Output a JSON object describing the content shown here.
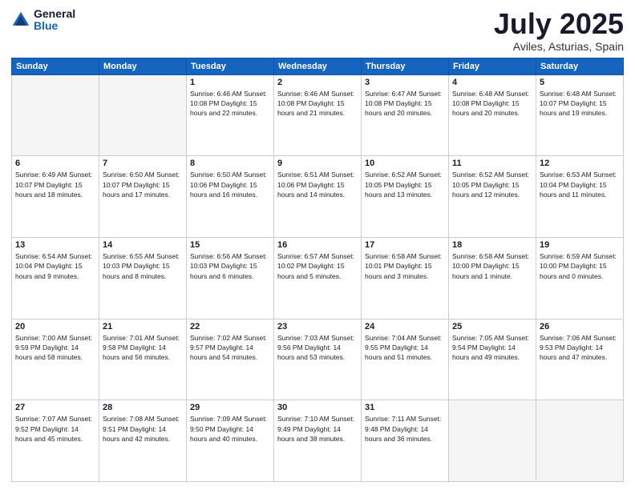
{
  "logo": {
    "general": "General",
    "blue": "Blue"
  },
  "title": "July 2025",
  "location": "Aviles, Asturias, Spain",
  "days_of_week": [
    "Sunday",
    "Monday",
    "Tuesday",
    "Wednesday",
    "Thursday",
    "Friday",
    "Saturday"
  ],
  "weeks": [
    [
      {
        "day": "",
        "info": ""
      },
      {
        "day": "",
        "info": ""
      },
      {
        "day": "1",
        "info": "Sunrise: 6:46 AM\nSunset: 10:08 PM\nDaylight: 15 hours\nand 22 minutes."
      },
      {
        "day": "2",
        "info": "Sunrise: 6:46 AM\nSunset: 10:08 PM\nDaylight: 15 hours\nand 21 minutes."
      },
      {
        "day": "3",
        "info": "Sunrise: 6:47 AM\nSunset: 10:08 PM\nDaylight: 15 hours\nand 20 minutes."
      },
      {
        "day": "4",
        "info": "Sunrise: 6:48 AM\nSunset: 10:08 PM\nDaylight: 15 hours\nand 20 minutes."
      },
      {
        "day": "5",
        "info": "Sunrise: 6:48 AM\nSunset: 10:07 PM\nDaylight: 15 hours\nand 19 minutes."
      }
    ],
    [
      {
        "day": "6",
        "info": "Sunrise: 6:49 AM\nSunset: 10:07 PM\nDaylight: 15 hours\nand 18 minutes."
      },
      {
        "day": "7",
        "info": "Sunrise: 6:50 AM\nSunset: 10:07 PM\nDaylight: 15 hours\nand 17 minutes."
      },
      {
        "day": "8",
        "info": "Sunrise: 6:50 AM\nSunset: 10:06 PM\nDaylight: 15 hours\nand 16 minutes."
      },
      {
        "day": "9",
        "info": "Sunrise: 6:51 AM\nSunset: 10:06 PM\nDaylight: 15 hours\nand 14 minutes."
      },
      {
        "day": "10",
        "info": "Sunrise: 6:52 AM\nSunset: 10:05 PM\nDaylight: 15 hours\nand 13 minutes."
      },
      {
        "day": "11",
        "info": "Sunrise: 6:52 AM\nSunset: 10:05 PM\nDaylight: 15 hours\nand 12 minutes."
      },
      {
        "day": "12",
        "info": "Sunrise: 6:53 AM\nSunset: 10:04 PM\nDaylight: 15 hours\nand 11 minutes."
      }
    ],
    [
      {
        "day": "13",
        "info": "Sunrise: 6:54 AM\nSunset: 10:04 PM\nDaylight: 15 hours\nand 9 minutes."
      },
      {
        "day": "14",
        "info": "Sunrise: 6:55 AM\nSunset: 10:03 PM\nDaylight: 15 hours\nand 8 minutes."
      },
      {
        "day": "15",
        "info": "Sunrise: 6:56 AM\nSunset: 10:03 PM\nDaylight: 15 hours\nand 6 minutes."
      },
      {
        "day": "16",
        "info": "Sunrise: 6:57 AM\nSunset: 10:02 PM\nDaylight: 15 hours\nand 5 minutes."
      },
      {
        "day": "17",
        "info": "Sunrise: 6:58 AM\nSunset: 10:01 PM\nDaylight: 15 hours\nand 3 minutes."
      },
      {
        "day": "18",
        "info": "Sunrise: 6:58 AM\nSunset: 10:00 PM\nDaylight: 15 hours\nand 1 minute."
      },
      {
        "day": "19",
        "info": "Sunrise: 6:59 AM\nSunset: 10:00 PM\nDaylight: 15 hours\nand 0 minutes."
      }
    ],
    [
      {
        "day": "20",
        "info": "Sunrise: 7:00 AM\nSunset: 9:59 PM\nDaylight: 14 hours\nand 58 minutes."
      },
      {
        "day": "21",
        "info": "Sunrise: 7:01 AM\nSunset: 9:58 PM\nDaylight: 14 hours\nand 56 minutes."
      },
      {
        "day": "22",
        "info": "Sunrise: 7:02 AM\nSunset: 9:57 PM\nDaylight: 14 hours\nand 54 minutes."
      },
      {
        "day": "23",
        "info": "Sunrise: 7:03 AM\nSunset: 9:56 PM\nDaylight: 14 hours\nand 53 minutes."
      },
      {
        "day": "24",
        "info": "Sunrise: 7:04 AM\nSunset: 9:55 PM\nDaylight: 14 hours\nand 51 minutes."
      },
      {
        "day": "25",
        "info": "Sunrise: 7:05 AM\nSunset: 9:54 PM\nDaylight: 14 hours\nand 49 minutes."
      },
      {
        "day": "26",
        "info": "Sunrise: 7:06 AM\nSunset: 9:53 PM\nDaylight: 14 hours\nand 47 minutes."
      }
    ],
    [
      {
        "day": "27",
        "info": "Sunrise: 7:07 AM\nSunset: 9:52 PM\nDaylight: 14 hours\nand 45 minutes."
      },
      {
        "day": "28",
        "info": "Sunrise: 7:08 AM\nSunset: 9:51 PM\nDaylight: 14 hours\nand 42 minutes."
      },
      {
        "day": "29",
        "info": "Sunrise: 7:09 AM\nSunset: 9:50 PM\nDaylight: 14 hours\nand 40 minutes."
      },
      {
        "day": "30",
        "info": "Sunrise: 7:10 AM\nSunset: 9:49 PM\nDaylight: 14 hours\nand 38 minutes."
      },
      {
        "day": "31",
        "info": "Sunrise: 7:11 AM\nSunset: 9:48 PM\nDaylight: 14 hours\nand 36 minutes."
      },
      {
        "day": "",
        "info": ""
      },
      {
        "day": "",
        "info": ""
      }
    ]
  ]
}
